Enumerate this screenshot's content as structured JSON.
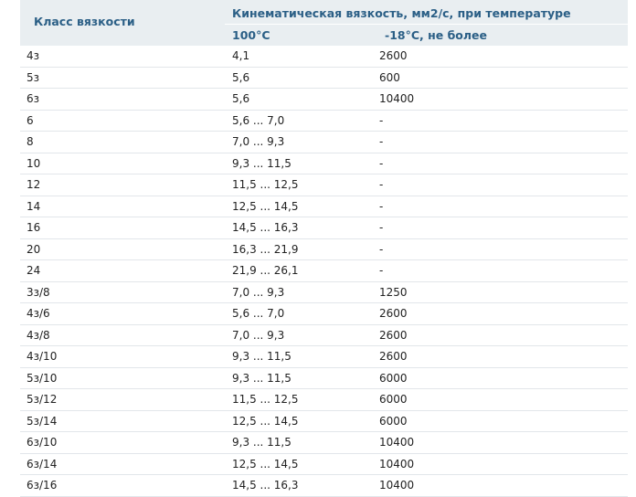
{
  "header": {
    "class_label": "Класс вязкости",
    "kinematic_label": "Кинематическая вязкость, мм2/с, при температуре",
    "temp_100": "100°С",
    "temp_minus18": "-18°С, не более"
  },
  "rows": [
    {
      "cls": "4з",
      "v100": "4,1",
      "v18": "2600"
    },
    {
      "cls": "5з",
      "v100": "5,6",
      "v18": "600"
    },
    {
      "cls": "6з",
      "v100": "5,6",
      "v18": "10400"
    },
    {
      "cls": "6",
      "v100": "5,6 ... 7,0",
      "v18": "-"
    },
    {
      "cls": "8",
      "v100": "7,0 ... 9,3",
      "v18": "-"
    },
    {
      "cls": "10",
      "v100": "9,3 ... 11,5",
      "v18": "-"
    },
    {
      "cls": "12",
      "v100": "11,5 ... 12,5",
      "v18": "-"
    },
    {
      "cls": "14",
      "v100": "12,5 ... 14,5",
      "v18": "-"
    },
    {
      "cls": "16",
      "v100": "14,5 ... 16,3",
      "v18": "-"
    },
    {
      "cls": "20",
      "v100": "16,3 ... 21,9",
      "v18": "-"
    },
    {
      "cls": "24",
      "v100": "21,9 ... 26,1",
      "v18": "-"
    },
    {
      "cls": "3з/8",
      "v100": "7,0 ... 9,3",
      "v18": "1250"
    },
    {
      "cls": "4з/6",
      "v100": "5,6 ... 7,0",
      "v18": "2600"
    },
    {
      "cls": "4з/8",
      "v100": "7,0 ... 9,3",
      "v18": "2600"
    },
    {
      "cls": "4з/10",
      "v100": "9,3 ... 11,5",
      "v18": "2600"
    },
    {
      "cls": "5з/10",
      "v100": "9,3 ... 11,5",
      "v18": "6000"
    },
    {
      "cls": "5з/12",
      "v100": "11,5 ... 12,5",
      "v18": "6000"
    },
    {
      "cls": "5з/14",
      "v100": "12,5 ... 14,5",
      "v18": "6000"
    },
    {
      "cls": "6з/10",
      "v100": "9,3 ... 11,5",
      "v18": "10400"
    },
    {
      "cls": "6з/14",
      "v100": "12,5 ... 14,5",
      "v18": "10400"
    },
    {
      "cls": "6з/16",
      "v100": "14,5 ... 16,3",
      "v18": "10400"
    }
  ]
}
